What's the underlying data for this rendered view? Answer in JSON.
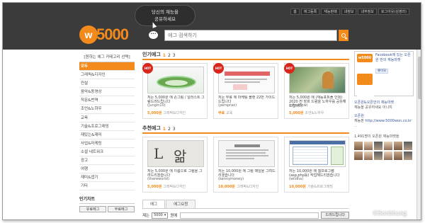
{
  "header": {
    "bubble_line1": "당신의 재능을",
    "bubble_line2": "공유하세요",
    "logo_mark": "w",
    "logo_text": "5000",
    "topnav": [
      "홈",
      "에그등록",
      "재능판매",
      "내정보",
      "내부정보",
      "로그아웃(김영라)"
    ],
    "search_placeholder": "에그 검색하기",
    "chat_icon": "chat-bubble-icon",
    "search_icon": "magnifier-icon"
  },
  "sidebar": {
    "title": "[원하는 에그 카테고리 선택]",
    "categories": [
      "모두",
      "그래픽&디자인",
      "컨설",
      "음악&동영상",
      "작문&번역",
      "조언&노하우",
      "교육",
      "기술&프로그래밍",
      "재밌는&재미",
      "사업&마케팅",
      "소셜 네트워크",
      "광고",
      "여행",
      "재미&엽기",
      "기타"
    ],
    "active_index": 0,
    "chart_title": "인기차트",
    "chart_tabs": [
      "유료에그",
      "무료에그"
    ]
  },
  "popular": {
    "title": "인기에그",
    "pages": [
      "1",
      "2",
      "3"
    ],
    "cards": [
      {
        "badge": "HOT",
        "title": "저는 5,000원 에 손그림 / 일러스트 그림드려드립니다",
        "author": "(jungin10)",
        "price": "5,000원",
        "category": "그래픽&디자인"
      },
      {
        "badge": "HOT",
        "title": "저는 무료 에 마케팅 블랜 22번 가이드 드립니다",
        "author": "(persprax)",
        "price": "무료",
        "category": "교육"
      },
      {
        "badge": "HOT",
        "title": "저는 5,000원 에 (재능포트폴 인데) 2020 전 장르 드럼을 노하우를 공유해드립니다.",
        "author": "(royalflow)",
        "price": "5,000원",
        "category": "조언&노하우"
      }
    ]
  },
  "recommended": {
    "title": "추천에그",
    "pages": [
      "1",
      "2",
      "3"
    ],
    "cards": [
      {
        "title": "저는 5,000원 에 이름으로 그림을 그려드리겠습니다",
        "author": "(thereworld)",
        "price": "5,000원",
        "category": "그래픽&디자인"
      },
      {
        "title": "저는 10,000원 에 그림 매일을 그려드리겠습니다",
        "author": "(kennymoney)",
        "price": "10,000원",
        "category": "그래픽&디자인"
      },
      {
        "title": "저는 10,000원 에 웹프로그램 (asp,php등) 작업해드리겠습니다",
        "author": "(wildha)",
        "price": "10,000원",
        "category": "기술&프로그래밍"
      }
    ]
  },
  "egg_tabs": [
    "에그",
    "에그요청"
  ],
  "filter": {
    "prefix": "제는",
    "select_value": "5000",
    "suffix": "원에",
    "button": "드려드립니다"
  },
  "right": {
    "facebook_text": "Facebook에 있는 오픈원 만의 재능마켓",
    "logo_label": "w5000",
    "like_label": "좋아요",
    "feed_title": "오픈원&오픈언의 재능마켓",
    "feed_text": "재능을 공유하세요 이니지",
    "feed_link_label": "오픈원",
    "feed_url_prefix": "재능판",
    "feed_url": "http://www.5000won.co.kr",
    "feed_more": "...",
    "fans_text": "1,491명이 오픈원 재능마켓을",
    "faces": 12
  },
  "watermark": "©Sonbbung"
}
